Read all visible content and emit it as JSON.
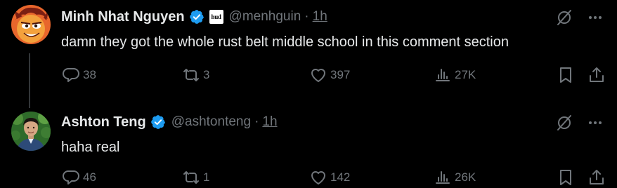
{
  "replies": [
    {
      "name": "Minh Nhat Nguyen",
      "affiliate_badge": "hud",
      "handle": "@menhguin",
      "separator": "·",
      "time": "1h",
      "text": "damn they got the whole rust belt middle school in this comment section",
      "reply_count": "38",
      "retweet_count": "3",
      "like_count": "397",
      "view_count": "27K"
    },
    {
      "name": "Ashton Teng",
      "handle": "@ashtonteng",
      "separator": "·",
      "time": "1h",
      "text": "haha real",
      "reply_count": "46",
      "retweet_count": "1",
      "like_count": "142",
      "view_count": "26K"
    }
  ],
  "icons": {
    "verified": "verified-badge-icon",
    "grok": "grok-icon",
    "more": "more-icon",
    "reply": "reply-icon",
    "retweet": "retweet-icon",
    "like": "heart-icon",
    "views": "views-icon",
    "bookmark": "bookmark-icon",
    "share": "share-icon"
  },
  "colors": {
    "background": "#000000",
    "text": "#e7e9ea",
    "secondary": "#71767b",
    "verified": "#1d9bf0"
  }
}
